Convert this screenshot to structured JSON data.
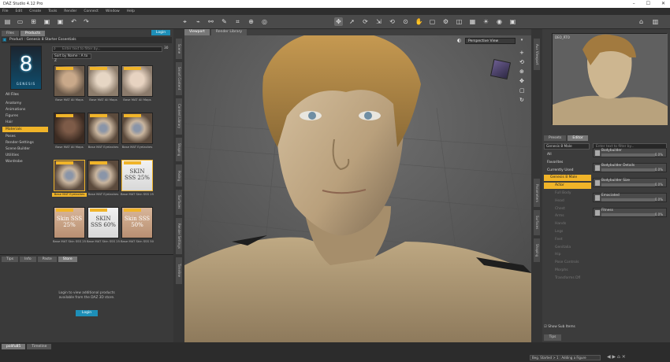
{
  "window": {
    "title": "DAZ Studio 4.12 Pro",
    "controls": [
      "–",
      "☐",
      "✕"
    ]
  },
  "menu": [
    "File",
    "Edit",
    "Create",
    "Tools",
    "Render",
    "Connect",
    "Window",
    "Help"
  ],
  "left": {
    "tabs": [
      "Files",
      "Products"
    ],
    "login_label": "Login",
    "product_label": "Product : Genesis 8 Starter Essentials",
    "search_placeholder": "Enter text to filter by...",
    "count": "30",
    "sort": "Sort by Name : A to Z",
    "product_badge": "8",
    "product_badge_sub": "GENESIS",
    "all_files": "All Files",
    "categories": [
      "Anatomy",
      "Animations",
      "Figures",
      "Hair",
      "Materials",
      "Poses",
      "Render-Settings",
      "Scene Builder",
      "Utilities",
      "Wardrobe"
    ],
    "selected_category": "Materials",
    "thumb_labels": [
      "Base MAT All Maps",
      "Base MAT All Maps",
      "Base MAT All Maps",
      "Base MAT All Maps",
      "Base MAT Eyelashes",
      "Base MAT Eyelashes",
      "Base MAT Eyelashes",
      "Base MAT Eyelashes",
      "Base MAT Skin SSS 25",
      "Base MAT Skin SSS 25",
      "Base MAT Skin SSS 25",
      "Base MAT Skin SSS 50"
    ],
    "thumb_texts": [
      "",
      "",
      "",
      "",
      "",
      "",
      "",
      "",
      "SKIN SSS 25%",
      "Skin SSS 25%",
      "SKIN SSS 60%",
      "Skin SSS 50%"
    ],
    "bottom_tabs": [
      "Tips",
      "Info",
      "Paste",
      "Store"
    ],
    "store_msg": "Login to view additional products available from the DAZ 3D store.",
    "store_login": "Login"
  },
  "left_vtabs": [
    "Scene",
    "Smart Content",
    "Content Library",
    "Shaping",
    "Posing",
    "Surfaces",
    "Render Settings",
    "Timeline"
  ],
  "viewport": {
    "tabs": [
      "Viewport",
      "Render Library"
    ],
    "camera_label": "Perspective View",
    "icons": [
      "plus-icon",
      "gear-icon",
      "orbit-icon",
      "zoom-icon",
      "pan-icon",
      "frame-icon"
    ]
  },
  "right_vtabs": [
    "Aux Viewport",
    "Parameters",
    "Surfaces",
    "Shaping"
  ],
  "right": {
    "aux_label": "DEO_RTO",
    "panel_tabs": [
      "Presets",
      "Editor"
    ],
    "search_placeholder": "Enter text to filter by...",
    "scope": "Genesis 8 Male",
    "tree": [
      {
        "label": "All"
      },
      {
        "label": "Favorites"
      },
      {
        "label": "Currently Used"
      },
      {
        "label": "Genesis 8 Male",
        "sel": true
      },
      {
        "label": "Actor",
        "sel": true
      },
      {
        "label": "Full Body"
      },
      {
        "label": "Head"
      },
      {
        "label": "Chest"
      },
      {
        "label": "Arms"
      },
      {
        "label": "Hands"
      },
      {
        "label": "Legs"
      },
      {
        "label": "Feet"
      },
      {
        "label": "Genitalia"
      },
      {
        "label": "Hip"
      },
      {
        "label": "Pose Controls"
      },
      {
        "label": "Morphs"
      },
      {
        "label": "Transforms Dfl"
      }
    ],
    "show_sub_items": "Show Sub Items",
    "bottom_tab": "Tips",
    "sliders": [
      {
        "label": "Bodybuilder",
        "value": "0.0%"
      },
      {
        "label": "Bodybuilder Details",
        "value": "0.0%"
      },
      {
        "label": "Bodybuilder Size",
        "value": "0.0%"
      },
      {
        "label": "Emaciated",
        "value": "0.0%"
      },
      {
        "label": "Fitness",
        "value": "0.0%"
      }
    ]
  },
  "status": {
    "tabs": [
      "polifu85",
      "Timeline"
    ],
    "lesson": "Beg. Started > 1 : Adding a Figure"
  }
}
